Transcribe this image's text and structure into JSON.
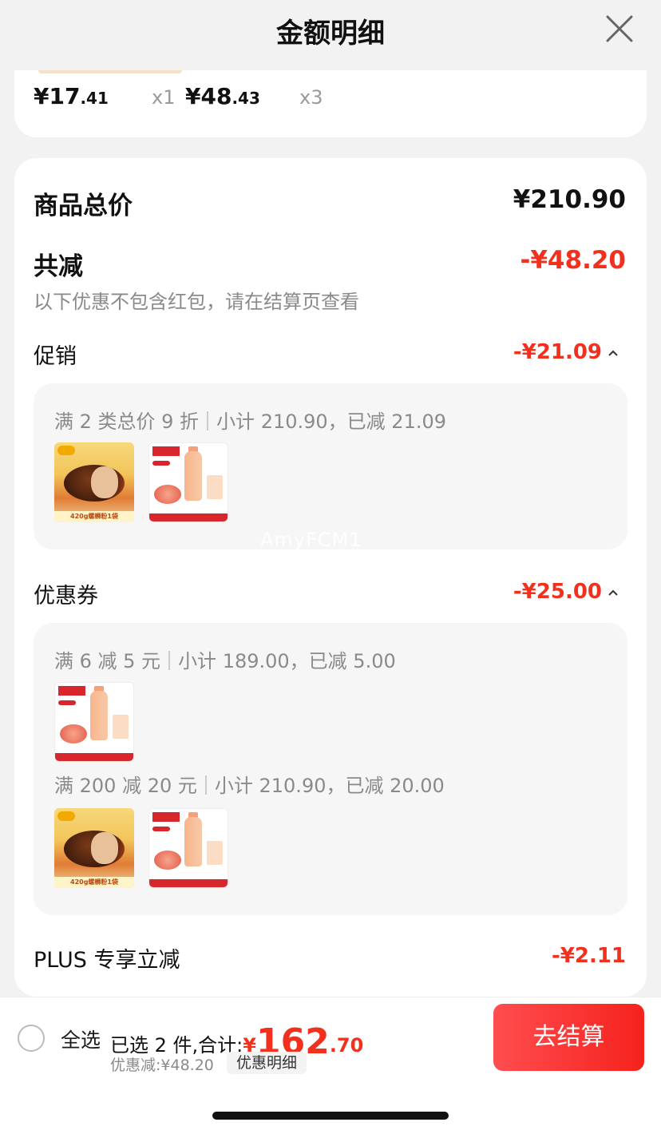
{
  "header": {
    "title": "金额明细"
  },
  "top_items": [
    {
      "price_main": "¥17",
      "price_dec": ".41",
      "qty": "x1"
    },
    {
      "price_main": "¥48",
      "price_dec": ".43",
      "qty": "x3"
    }
  ],
  "summary": {
    "total_label": "商品总价",
    "total_value": "¥210.90",
    "reduce_label": "共减",
    "reduce_value": "-¥48.20",
    "note": "以下优惠不包含红包，请在结算页查看"
  },
  "promotion": {
    "label": "促销",
    "value": "-¥21.09",
    "rule_name": "满 2 类总价 9 折",
    "rule_detail": "小计 210.90，已减 21.09"
  },
  "coupon": {
    "label": "优惠券",
    "value": "-¥25.00",
    "rule1_name": "满 6 减 5 元",
    "rule1_detail": "小计 189.00，已减 5.00",
    "rule2_name": "满 200 减 20 元",
    "rule2_detail": "小计 210.90，已减 20.00"
  },
  "plus": {
    "label": "PLUS 专享立减",
    "value": "-¥2.11"
  },
  "watermark": "AmyFCM1",
  "thumbs": {
    "noodle_strip": "420g螺蛳粉1袋"
  },
  "bottom": {
    "select_all": "全选",
    "selected_text": "已选 2 件,合计:",
    "total_symbol": "¥",
    "total_int": "162",
    "total_dec": ".70",
    "discount_text": "优惠减:¥48.20",
    "detail_button": "优惠明细",
    "checkout_button": "去结算"
  },
  "colors": {
    "accent": "#f2301e",
    "checkout_bg": "#f5221d",
    "muted": "#8a8a8a"
  }
}
